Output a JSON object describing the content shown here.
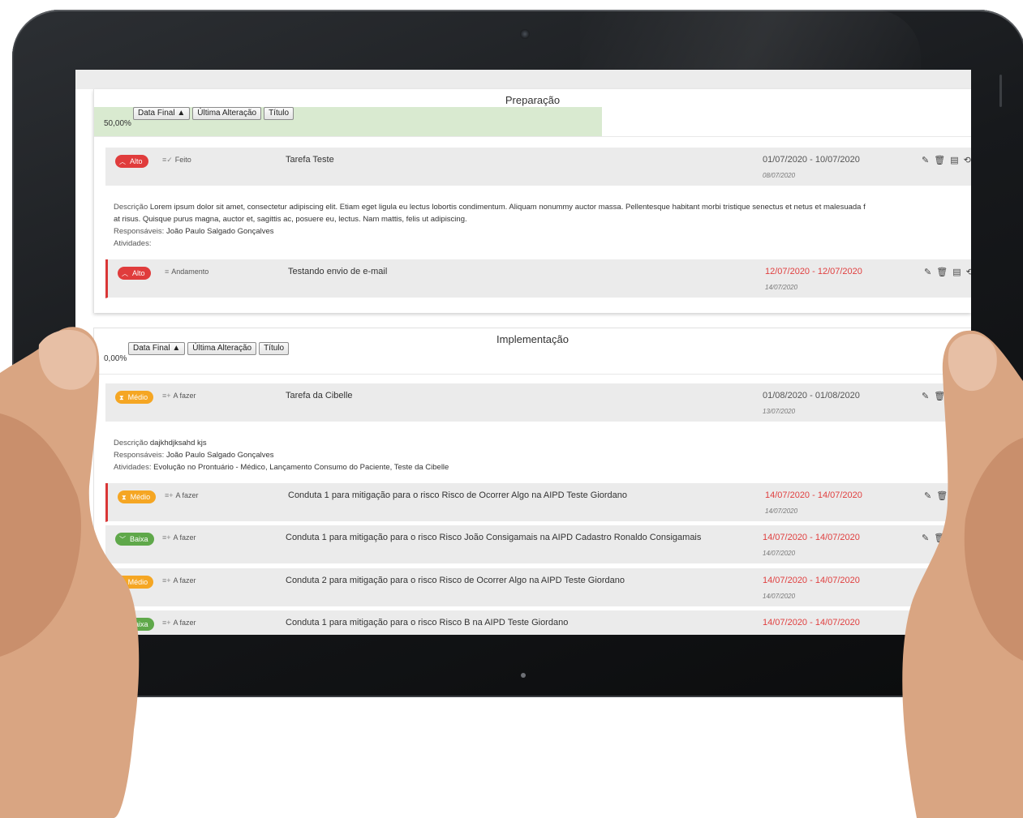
{
  "stages": [
    {
      "title": "Preparação",
      "progress": "50,00%",
      "progress_fraction": 0.5,
      "sort_buttons": [
        "Data Final ▲",
        "Última Alteração",
        "Título"
      ],
      "tasks": [
        {
          "priority": "Alto",
          "priority_color": "#e03c3c",
          "status": "Feito",
          "title": "Tarefa Teste",
          "date_range": "01/07/2020 - 10/07/2020",
          "updated": "08/07/2020",
          "late": false,
          "description_label": "Descrição",
          "description": "Lorem ipsum dolor sit amet, consectetur adipiscing elit. Etiam eget ligula eu lectus lobortis condimentum. Aliquam nonummy auctor massa. Pellentesque habitant morbi tristique senectus et netus et malesuada f",
          "description_2": "at risus. Quisque purus magna, auctor et, sagittis ac, posuere eu, lectus. Nam mattis, felis ut adipiscing.",
          "responsaveis_label": "Responsáveis:",
          "responsaveis": "João Paulo Salgado Gonçalves",
          "atividades_label": "Atividades:",
          "atividades": ""
        },
        {
          "priority": "Alto",
          "priority_color": "#e03c3c",
          "status": "Andamento",
          "title": "Testando envio de e-mail",
          "date_range": "12/07/2020 - 12/07/2020",
          "updated": "14/07/2020",
          "late": true
        }
      ]
    },
    {
      "title": "Implementação",
      "progress": "0,00%",
      "progress_fraction": 0.0,
      "sort_buttons": [
        "Data Final ▲",
        "Última Alteração",
        "Título"
      ],
      "tasks": [
        {
          "priority": "Médio",
          "priority_color": "#f5a623",
          "status": "A fazer",
          "title": "Tarefa da Cibelle",
          "date_range": "01/08/2020 - 01/08/2020",
          "updated": "13/07/2020",
          "late": false,
          "description_label": "Descrição",
          "description": "dajkhdjksahd kjs",
          "responsaveis_label": "Responsáveis:",
          "responsaveis": "João Paulo Salgado Gonçalves",
          "atividades_label": "Atividades:",
          "atividades": "Evolução no Prontuário - Médico, Lançamento Consumo do Paciente, Teste da Cibelle"
        },
        {
          "priority": "Médio",
          "priority_color": "#f5a623",
          "status": "A fazer",
          "title": "Conduta 1 para mitigação para o risco Risco de Ocorrer Algo na AIPD Teste Giordano",
          "date_range": "14/07/2020 - 14/07/2020",
          "updated": "14/07/2020",
          "late": true
        },
        {
          "priority": "Baixa",
          "priority_color": "#5fa84a",
          "status": "A fazer",
          "title": "Conduta 1 para mitigação para o risco Risco João Consigamais na AIPD Cadastro Ronaldo Consigamais",
          "date_range": "14/07/2020 - 14/07/2020",
          "updated": "14/07/2020",
          "late": true
        },
        {
          "priority": "Médio",
          "priority_color": "#f5a623",
          "status": "A fazer",
          "title": "Conduta 2 para mitigação para o risco Risco de Ocorrer Algo na AIPD Teste Giordano",
          "date_range": "14/07/2020 - 14/07/2020",
          "updated": "14/07/2020",
          "late": true
        },
        {
          "priority": "Baixa",
          "priority_color": "#5fa84a",
          "status": "A fazer",
          "title": "Conduta 1 para mitigação para o risco Risco B na AIPD Teste Giordano",
          "date_range": "14/07/2020 - 14/07/2020",
          "updated": "",
          "late": true
        }
      ]
    }
  ],
  "icons": {
    "edit": "pencil-icon",
    "delete": "trash-icon",
    "comment": "comment-icon",
    "history": "history-icon"
  }
}
